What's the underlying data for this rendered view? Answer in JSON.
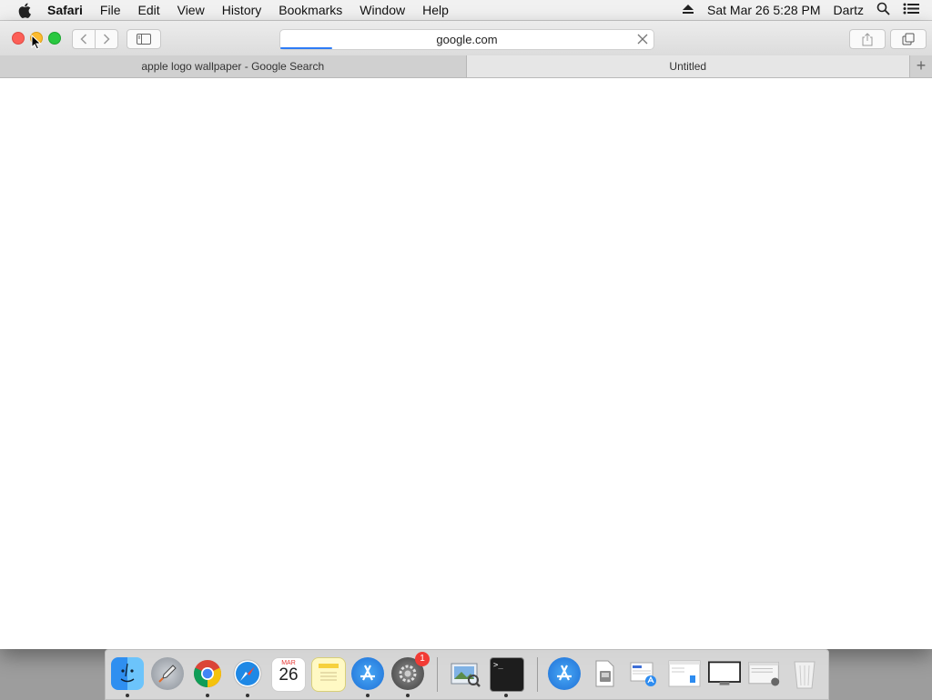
{
  "menubar": {
    "app": "Safari",
    "items": [
      "File",
      "Edit",
      "View",
      "History",
      "Bookmarks",
      "Window",
      "Help"
    ],
    "datetime": "Sat Mar 26  5:28 PM",
    "user": "Dartz"
  },
  "toolbar": {
    "address": "google.com",
    "load_progress": 0.14
  },
  "tabs": [
    {
      "label": "apple logo wallpaper - Google Search",
      "active": false
    },
    {
      "label": "Untitled",
      "active": true
    }
  ],
  "newtab_label": "+",
  "dock": {
    "apps": [
      {
        "name": "finder-icon",
        "running": true
      },
      {
        "name": "launchpad-icon",
        "running": false
      },
      {
        "name": "chrome-icon",
        "running": true
      },
      {
        "name": "safari-icon",
        "running": true
      },
      {
        "name": "calendar-icon",
        "running": false,
        "label": "26",
        "month": "MAR"
      },
      {
        "name": "notes-icon",
        "running": false
      },
      {
        "name": "app-store-icon",
        "running": true
      },
      {
        "name": "system-preferences-icon",
        "running": true,
        "badge": "1"
      },
      {
        "name": "preview-icon",
        "running": false
      },
      {
        "name": "terminal-icon",
        "running": true
      }
    ],
    "docs": [
      {
        "name": "downloads-folder-icon"
      },
      {
        "name": "disk-icon"
      },
      {
        "name": "document-icon"
      },
      {
        "name": "document-icon"
      },
      {
        "name": "screen-icon"
      },
      {
        "name": "document-icon"
      },
      {
        "name": "trash-icon"
      }
    ],
    "terminal_prompt": ">_"
  },
  "colors": {
    "accent": "#2e7cf6",
    "close": "#fc5f57",
    "minimize": "#fdbb2e",
    "zoom": "#29c840"
  }
}
